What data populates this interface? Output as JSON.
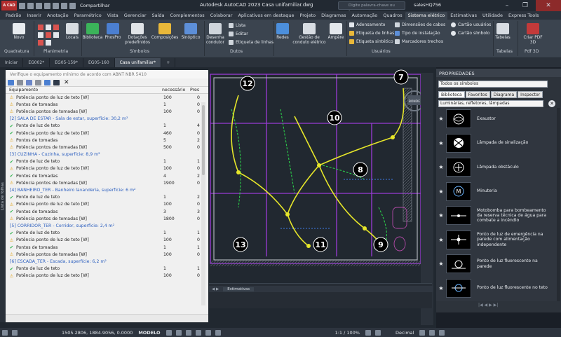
{
  "app": {
    "logo": "A CAD",
    "title": "Autodesk AutoCAD 2023   Casa unifamiliar.dwg",
    "share": "Compartilhar",
    "search_placeholder": "Digite palavra-chave ou frase",
    "user": "salesHQ756"
  },
  "ribbon_tabs": [
    "Padrão",
    "Inserir",
    "Anotação",
    "Paramétrico",
    "Vista",
    "Gerenciar",
    "Saída",
    "Complementos",
    "Colaborar",
    "Aplicativos em destaque",
    "Projeto",
    "Diagramas",
    "Automação",
    "Quadros",
    "Sistema elétrico",
    "Estimativas",
    "Utilidade",
    "Express Tools"
  ],
  "ribbon_active": "Sistema elétrico",
  "ribbon": {
    "novo": "Novo",
    "locais": "Locais",
    "biblioteca": "Biblioteca",
    "phospro": "PhosPro",
    "dotacoes": "Dotações predefinidos",
    "composicoes": "Composições",
    "sinoptico": "Sinóptico",
    "desenha_condutor": "Desenha condutor",
    "lista": "Lista",
    "editar": "Editar",
    "etiqueta_linhas": "Etiqueta de linhas",
    "redes": "Redes",
    "gestao": "Gestão de conduto elétrico",
    "ampere": "Ampère",
    "adensamento": "Adensamento",
    "etiqueta_linhas2": "Etiqueta de linhas",
    "etiqueta_sintetico": "Etiqueta sintético",
    "dimensoes_cabos": "Dimensões de cabos",
    "tipo_instalacao": "Tipo de instalação",
    "marcadores": "Marcadores trechos",
    "cartao_usuarios": "Cartão usuários",
    "cartao_simbolo": "Cartão símbolo",
    "tabelas": "Tabelas",
    "criar_pdf": "Criar PDF 3D",
    "groups": {
      "quadratura": "Quadratura",
      "planimetria": "Planimetria",
      "simbolos": "Símbolos",
      "dutos": "Dutos",
      "usuarios": "Usuários",
      "tabelas": "Tabelas",
      "pdf3d": "Pdf 3D"
    }
  },
  "doc_tabs": [
    "Iniciar",
    "EG002*",
    "EG05-159*",
    "EG05-160",
    "Casa unifamiliar*"
  ],
  "doc_active": "Casa unifamiliar*",
  "panel": {
    "title": "Verifique o equipamento mínimo de acordo com ABNT NBR 5410",
    "columns": [
      "Equipamento",
      "necessário",
      "Pres"
    ],
    "rows": [
      {
        "type": "warn",
        "name": "Potência ponto de luz de teto [W]",
        "req": "100",
        "pres": "0"
      },
      {
        "type": "warn",
        "name": "Pontos de tomadas",
        "req": "1",
        "pres": "0"
      },
      {
        "type": "warn",
        "name": "Potência pontos de tomadas [W]",
        "req": "100",
        "pres": "0"
      },
      {
        "type": "sec",
        "name": "[2] SALA DE ESTAR - Sala de estar, superfície: 30,2 m²"
      },
      {
        "type": "ok",
        "name": "Ponto de luz de teto",
        "req": "1",
        "pres": "4"
      },
      {
        "type": "ok",
        "name": "Potência ponto de luz de teto [W]",
        "req": "460",
        "pres": "0"
      },
      {
        "type": "warn",
        "name": "Pontos de tomadas",
        "req": "5",
        "pres": "2"
      },
      {
        "type": "warn",
        "name": "Potência pontos de tomadas [W]",
        "req": "500",
        "pres": "0"
      },
      {
        "type": "sec",
        "name": "[3] CUZINHA - Cuzinha, superfície: 8,9 m²"
      },
      {
        "type": "ok",
        "name": "Ponto de luz de teto",
        "req": "1",
        "pres": "1"
      },
      {
        "type": "warn",
        "name": "Potência ponto de luz de teto [W]",
        "req": "100",
        "pres": "0"
      },
      {
        "type": "ok",
        "name": "Pontos de tomadas",
        "req": "4",
        "pres": "2"
      },
      {
        "type": "warn",
        "name": "Potência pontos de tomadas [W]",
        "req": "1900",
        "pres": "0"
      },
      {
        "type": "sec",
        "name": "[4] BANHEIRO_TER - Banheiro lavanderia, superfície: 6 m²"
      },
      {
        "type": "ok",
        "name": "Ponto de luz de teto",
        "req": "1",
        "pres": "2"
      },
      {
        "type": "warn",
        "name": "Potência ponto de luz de teto [W]",
        "req": "100",
        "pres": "0"
      },
      {
        "type": "ok",
        "name": "Pontos de tomadas",
        "req": "3",
        "pres": "3"
      },
      {
        "type": "warn",
        "name": "Potência pontos de tomadas [W]",
        "req": "1800",
        "pres": "0"
      },
      {
        "type": "sec",
        "name": "[5] CORRIDOR_TER - Corridor, superfície: 2,4 m²"
      },
      {
        "type": "ok",
        "name": "Ponto de luz de teto",
        "req": "1",
        "pres": "1"
      },
      {
        "type": "warn",
        "name": "Potência ponto de luz de teto [W]",
        "req": "100",
        "pres": "0"
      },
      {
        "type": "ok",
        "name": "Pontos de tomadas",
        "req": "1",
        "pres": "1"
      },
      {
        "type": "warn",
        "name": "Potência pontos de tomadas [W]",
        "req": "100",
        "pres": "0"
      },
      {
        "type": "sec",
        "name": "[6] ESCADA_TER - Escada, superfície: 6,2 m²"
      },
      {
        "type": "ok",
        "name": "Ponto de luz de teto",
        "req": "1",
        "pres": "1"
      },
      {
        "type": "warn",
        "name": "Potência ponto de luz de teto [W]",
        "req": "100",
        "pres": "0"
      }
    ]
  },
  "left_strip": "Lista de folhas",
  "properties": {
    "title": "PROPRIEDADES",
    "filter": "Todos os símbolos",
    "tabs": [
      "Biblioteca",
      "Favoritos",
      "Diagrama",
      "Inspector"
    ],
    "active_tab": "Biblioteca",
    "category": "Luminárias, refletores, lâmpadas",
    "items": [
      "Exaustor",
      "Lâmpada de sinalização",
      "Lâmpada obstáculo",
      "Minuteria",
      "Motobomba para bombeamento da reserva técnica de água para combate a incêndio",
      "Ponto de luz de emergência na parede com alimentação independente",
      "Ponto de luz fluorescente na parede",
      "Ponto de luz fluorescente no teto"
    ]
  },
  "drawing": {
    "room_numbers": [
      "12",
      "10",
      "8",
      "7",
      "13",
      "11",
      "9"
    ],
    "viewcube": "BONDE"
  },
  "layout_tabs": [
    "Estimativas"
  ],
  "status": {
    "coords": "1505.2806, 1884.9056, 0.0000",
    "mode": "MODELO",
    "scale": "1:1 / 100%",
    "units": "Decimal"
  },
  "colors": {
    "accent": "#b22e2e",
    "canvas": "#212830",
    "conductor": "#e6e62a",
    "wall": "#9a3bd6",
    "green": "#2bcf4a"
  }
}
